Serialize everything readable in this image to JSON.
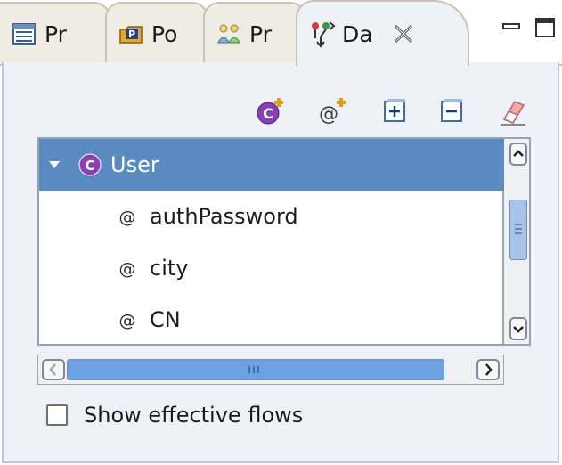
{
  "tabs": [
    {
      "label": "Pr",
      "icon": "list-view-icon",
      "active": false
    },
    {
      "label": "Po",
      "icon": "package-p-icon",
      "active": false
    },
    {
      "label": "Pr",
      "icon": "people-icon",
      "active": false
    },
    {
      "label": "Da",
      "icon": "data-flow-icon",
      "active": true
    }
  ],
  "window_controls": {
    "minimize_icon": "minimize-icon",
    "maximize_icon": "maximize-icon"
  },
  "toolbar": {
    "buttons": [
      {
        "icon": "add-class-icon"
      },
      {
        "icon": "add-attribute-icon"
      },
      {
        "icon": "expand-all-icon"
      },
      {
        "icon": "collapse-all-icon"
      },
      {
        "icon": "eraser-icon"
      }
    ]
  },
  "tree": {
    "root": {
      "label": "User",
      "icon": "class-c-icon",
      "expanded": true,
      "selected": true
    },
    "children": [
      {
        "label": "authPassword",
        "icon": "attribute-at-icon"
      },
      {
        "label": "city",
        "icon": "attribute-at-icon"
      },
      {
        "label": "CN",
        "icon": "attribute-at-icon"
      }
    ]
  },
  "scrollbars": {
    "horizontal_grip": "III",
    "vertical_grip": "≡"
  },
  "checkbox": {
    "label": "Show effective flows",
    "checked": false
  },
  "colors": {
    "selection": "#5b8ac0",
    "class_badge": "#8a3fb3",
    "panel": "#eef2f8"
  }
}
